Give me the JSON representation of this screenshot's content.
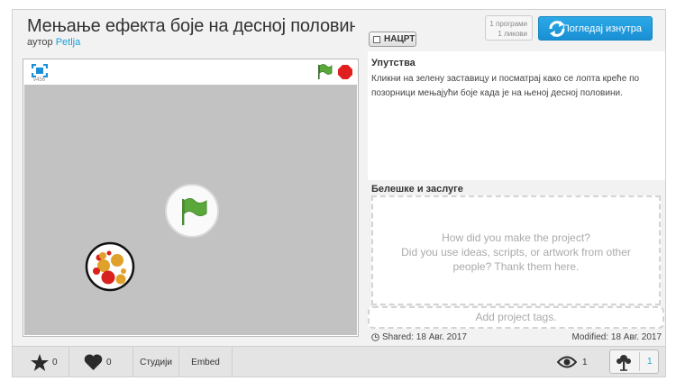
{
  "project": {
    "title": "Мењање ефекта боје на десној половини позорнице",
    "by_label": "аутор",
    "author": "Petlja",
    "draft_label": "НАЦРТ",
    "counts": {
      "scripts": "1 програми",
      "sprites": "1 ликови"
    },
    "see_inside_label": "Погледај изнутра"
  },
  "player": {
    "version": "v456",
    "icons": [
      "fullscreen-icon",
      "green-flag-icon",
      "stop-icon"
    ]
  },
  "instructions": {
    "title": "Упутства",
    "text": "Кликни на зелену заставицу и посматрај како се лопта креће по позорници мењајући боје када је на њеној десној половини."
  },
  "credits": {
    "title": "Белешке и заслуге",
    "placeholder_line1": "How did you make the project?",
    "placeholder_line2": "Did you use ideas, scripts, or artwork from other",
    "placeholder_line3": "people? Thank them here."
  },
  "tags": {
    "placeholder": "Add project tags."
  },
  "meta": {
    "shared": "Shared: 18 Авг. 2017",
    "modified": "Modified: 18 Авг. 2017"
  },
  "footer": {
    "loves": "0",
    "favorites": "0",
    "studios_label": "Студији",
    "embed_label": "Embed",
    "views": "1",
    "remixes": "1"
  },
  "colors": {
    "accent": "#1aa0d8",
    "stage": "#c2c2c2",
    "flag": "#5aa83a",
    "stop": "#e0201e"
  }
}
